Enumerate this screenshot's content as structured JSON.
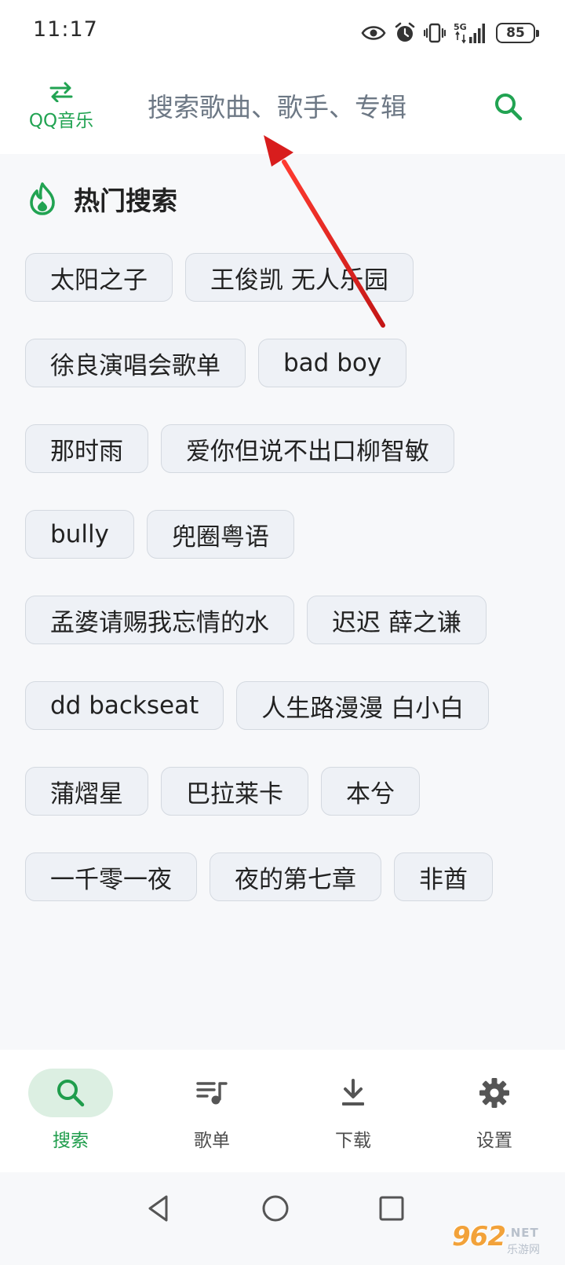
{
  "status_bar": {
    "time": "11:17",
    "network_label": "5G",
    "battery_level": "85",
    "icons": [
      "eye-icon",
      "alarm-icon",
      "vibrate-icon",
      "signal-icon",
      "battery-icon"
    ]
  },
  "header": {
    "switch_label": "QQ音乐",
    "search_placeholder": "搜索歌曲、歌手、专辑"
  },
  "hot_search": {
    "title": "热门搜索",
    "tags": [
      "太阳之子",
      "王俊凯 无人乐园",
      "徐良演唱会歌单",
      "bad boy",
      "那时雨",
      "爱你但说不出口柳智敏",
      "bully",
      "兜圈粤语",
      "孟婆请赐我忘情的水",
      "迟迟 薛之谦",
      "dd backseat",
      "人生路漫漫 白小白",
      "蒲熠星",
      "巴拉莱卡",
      "本兮",
      "一千零一夜",
      "夜的第七章",
      "非酋"
    ]
  },
  "bottom_nav": {
    "active": "search",
    "items": [
      {
        "id": "search",
        "label": "搜索",
        "icon": "search-icon"
      },
      {
        "id": "playlist",
        "label": "歌单",
        "icon": "playlist-icon"
      },
      {
        "id": "download",
        "label": "下载",
        "icon": "download-icon"
      },
      {
        "id": "settings",
        "label": "设置",
        "icon": "gear-icon"
      }
    ]
  },
  "watermark": {
    "big": "962",
    "small_top": ".NET",
    "small_bottom": "乐游网"
  },
  "colors": {
    "accent": "#21a352",
    "active_pill": "#dcefe2",
    "tag_background": "#eef1f6",
    "page_background": "#f7f8fa",
    "annotation_arrow": "#e02424"
  }
}
